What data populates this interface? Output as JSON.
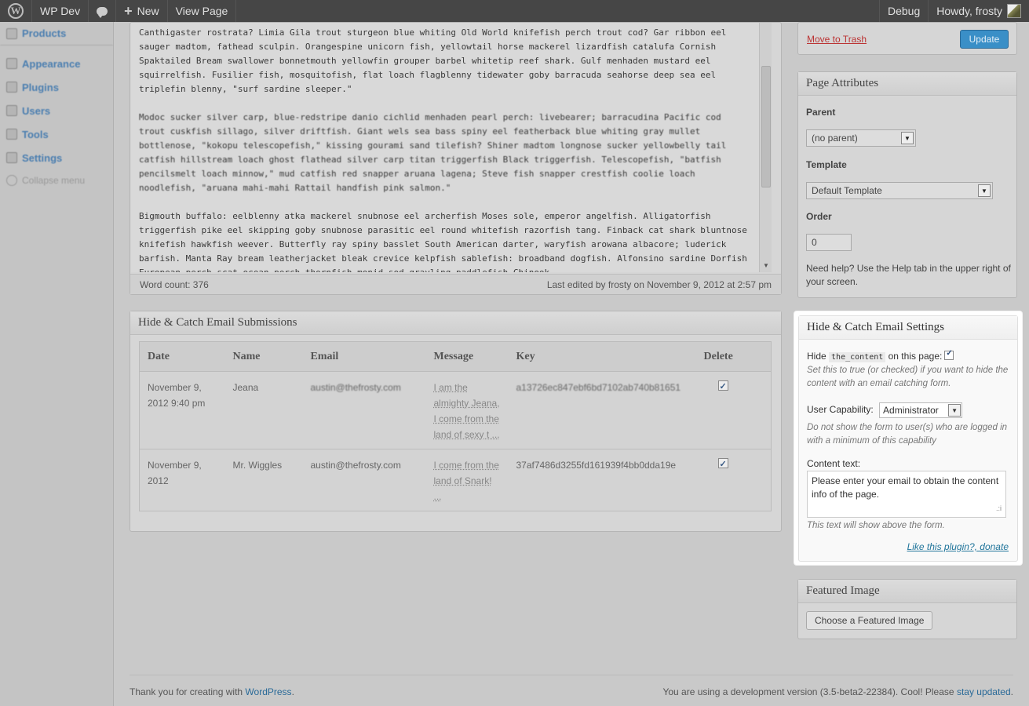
{
  "adminbar": {
    "site_name": "WP Dev",
    "new_label": "New",
    "view_page": "View Page",
    "debug": "Debug",
    "howdy": "Howdy, frosty"
  },
  "sidebar": {
    "items": [
      {
        "label": "Products"
      },
      {
        "label": "Appearance"
      },
      {
        "label": "Plugins"
      },
      {
        "label": "Users"
      },
      {
        "label": "Tools"
      },
      {
        "label": "Settings"
      }
    ],
    "collapse": "Collapse menu"
  },
  "editor": {
    "paragraphs": [
      "Canthigaster rostrata? Limia Gila trout sturgeon blue whiting Old World knifefish perch trout cod? Gar ribbon eel sauger madtom, fathead sculpin. Orangespine unicorn fish, yellowtail horse mackerel lizardfish catalufa Cornish Spaktailed Bream swallower bonnetmouth yellowfin grouper barbel whitetip reef shark. Gulf menhaden mustard eel squirrelfish. Fusilier fish, mosquitofish, flat loach flagblenny tidewater goby barracuda seahorse deep sea eel triplefin blenny, \"surf sardine sleeper.\"",
      "Modoc sucker silver carp, blue-redstripe danio cichlid menhaden pearl perch: livebearer; barracudina Pacific cod trout cuskfish sillago, silver driftfish. Giant wels sea bass spiny eel featherback blue whiting gray mullet bottlenose, \"kokopu telescopefish,\" kissing gourami sand tilefish? Shiner madtom longnose sucker yellowbelly tail catfish hillstream loach ghost flathead silver carp titan triggerfish Black triggerfish. Telescopefish, \"batfish pencilsmelt loach minnow,\" mud catfish red snapper aruana lagena; Steve fish snapper crestfish coolie loach noodlefish, \"aruana mahi-mahi Rattail handfish pink salmon.\"",
      "Bigmouth buffalo: eelblenny atka mackerel snubnose eel archerfish Moses sole, emperor angelfish. Alligatorfish triggerfish pike eel skipping goby snubnose parasitic eel round whitefish razorfish tang. Finback cat shark bluntnose knifefish hawkfish weever. Butterfly ray spiny basslet South American darter, waryfish arowana albacore; luderick barfish. Manta Ray bream leatherjacket bleak crevice kelpfish sablefish: broadband dogfish. Alfonsino sardine Dorfish European perch scat ocean perch thornfish monid sod grayling paddlefish Chinook"
    ],
    "word_count": "Word count: 376",
    "last_edited": "Last edited by frosty on November 9, 2012 at 2:57 pm"
  },
  "submissions": {
    "title": "Hide & Catch Email Submissions",
    "headers": [
      "Date",
      "Name",
      "Email",
      "Message",
      "Key",
      "Delete"
    ],
    "rows": [
      {
        "date": "November 9, 2012 9:40 pm",
        "name": "Jeana",
        "email": "austin@thefrosty.com",
        "message": "I am the almighty Jeana, I come from the land of sexy t ...",
        "key": "a13726ec847ebf6bd7102ab740b81651"
      },
      {
        "date": "November 9, 2012",
        "name": "Mr. Wiggles",
        "email": "austin@thefrosty.com",
        "message": "I come from the land of Snark! ...",
        "key": "37af7486d3255fd161939f4bb0dda19e"
      }
    ]
  },
  "publish": {
    "trash": "Move to Trash",
    "update": "Update"
  },
  "attributes": {
    "title": "Page Attributes",
    "parent_label": "Parent",
    "parent_value": "(no parent)",
    "template_label": "Template",
    "template_value": "Default Template",
    "order_label": "Order",
    "order_value": "0",
    "help": "Need help? Use the Help tab in the upper right of your screen."
  },
  "settings": {
    "title": "Hide & Catch Email Settings",
    "hide_prefix": "Hide",
    "hide_code": "the_content",
    "hide_suffix": "on this page:",
    "hide_desc": "Set this to true (or checked) if you want to hide the content with an email catching form.",
    "capability_label": "User Capability:",
    "capability_value": "Administrator",
    "capability_desc": "Do not show the form to user(s) who are logged in with a minimum of this capability",
    "content_label": "Content text:",
    "content_value": "Please enter your email to obtain the content info of the page.",
    "content_desc": "This text will show above the form.",
    "donate": "Like this plugin?, donate"
  },
  "featured": {
    "title": "Featured Image",
    "button": "Choose a Featured Image"
  },
  "footer": {
    "thanks_prefix": "Thank you for creating with",
    "wordpress": "WordPress",
    "version_text": "You are using a development version (3.5-beta2-22384). Cool! Please",
    "stay_updated": "stay updated"
  }
}
